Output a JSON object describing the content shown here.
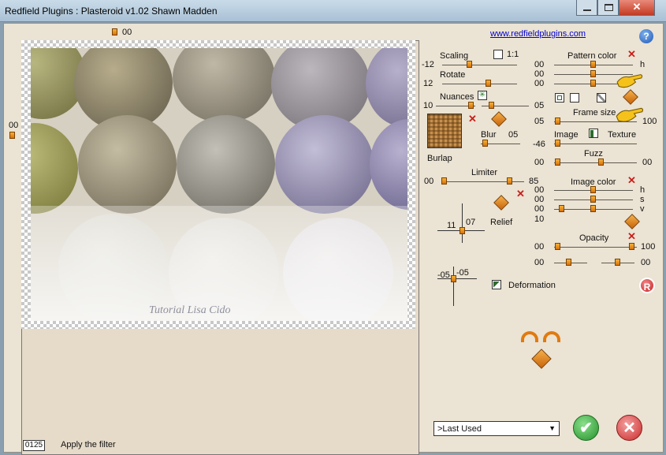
{
  "window": {
    "title": "Redfield Plugins : Plasteroid v1.02   Shawn Madden"
  },
  "colors": {
    "accent_orange": "#e8911f",
    "red_x": "#c8201c",
    "ok_green": "#3aa93a",
    "cancel_red": "#d93535",
    "help_blue": "#2e6fc8"
  },
  "preview": {
    "top_value": "00",
    "left_value": "00",
    "watermark": "Tutorial Lisa Cido",
    "status_value": "0125",
    "status_text": "Apply the filter"
  },
  "link": "www.redfieldplugins.com",
  "scaling": {
    "label": "Scaling",
    "value": "-12",
    "ratio_label": "1:1"
  },
  "rotate": {
    "label": "Rotate",
    "value": "12"
  },
  "nuances": {
    "label": "Nuances",
    "value_left": "10",
    "value_right": "05"
  },
  "texture": {
    "name": "Burlap"
  },
  "blur": {
    "label": "Blur",
    "value": "05"
  },
  "limiter": {
    "label": "Limiter",
    "value_left": "00",
    "value_right": "85"
  },
  "relief": {
    "label": "Relief",
    "x": "11",
    "y": "07"
  },
  "deformation": {
    "label": "Deformation",
    "x": "-05",
    "y": "-05"
  },
  "pattern_color": {
    "label": "Pattern color",
    "rows": [
      {
        "value": "00",
        "channel": "h"
      },
      {
        "value": "00",
        "channel": ""
      },
      {
        "value": "00",
        "channel": ""
      }
    ]
  },
  "frame_size": {
    "label": "Frame size",
    "value_left": "05",
    "value_right": "100"
  },
  "image_texture": {
    "image_label": "Image",
    "texture_label": "Texture",
    "value": "-46"
  },
  "fuzz": {
    "label": "Fuzz",
    "value_left": "00",
    "value_right": "00"
  },
  "image_color": {
    "label": "Image color",
    "rows": [
      {
        "value": "00",
        "channel": "h"
      },
      {
        "value": "00",
        "channel": "s"
      },
      {
        "value": "00",
        "channel": "v"
      }
    ],
    "extra_value": "10"
  },
  "opacity": {
    "label": "Opacity",
    "value_left": "00",
    "value_right": "100",
    "row2_left": "00",
    "row2_right": "00"
  },
  "preset": {
    "selected": ">Last Used"
  }
}
